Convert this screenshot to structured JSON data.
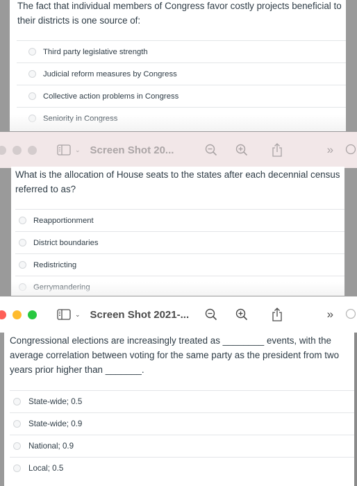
{
  "questions": [
    {
      "text": "The fact that individual members of Congress favor costly projects beneficial to their districts is one source of:",
      "answers": [
        {
          "label": "Third party legislative strength",
          "selected": false
        },
        {
          "label": "Judicial reform measures by Congress",
          "selected": false
        },
        {
          "label": "Collective action problems in Congress",
          "selected": false
        },
        {
          "label": "Seniority in Congress",
          "selected": false
        }
      ]
    },
    {
      "text": "What is the allocation of House seats to the states after each decennial census referred to as?",
      "answers": [
        {
          "label": "Reapportionment",
          "selected": false
        },
        {
          "label": "District boundaries",
          "selected": false
        },
        {
          "label": "Redistricting",
          "selected": false
        },
        {
          "label": "Gerrymandering",
          "selected": false
        }
      ]
    },
    {
      "text": "Congressional elections are increasingly treated as ________ events, with the average correlation between voting for the same party as the president from two years prior higher than _______.",
      "answers": [
        {
          "label": "State-wide; 0.5",
          "selected": false
        },
        {
          "label": "State-wide; 0.9",
          "selected": false
        },
        {
          "label": "National; 0.9",
          "selected": false
        },
        {
          "label": "Local; 0.5",
          "selected": false
        }
      ]
    }
  ],
  "toolbars": [
    {
      "title": "Screen Shot 20...",
      "state": "inactive",
      "icons": {
        "sidebar": "sidebar-icon",
        "chevron": "⌄",
        "zoom_out": "zoom-out-icon",
        "zoom_in": "zoom-in-icon",
        "share": "share-icon",
        "more": "»",
        "search": "search-icon"
      }
    },
    {
      "title": "Screen Shot 2021-...",
      "state": "active",
      "icons": {
        "sidebar": "sidebar-icon",
        "chevron": "⌄",
        "zoom_out": "zoom-out-icon",
        "zoom_in": "zoom-in-icon",
        "share": "share-icon",
        "more": "»",
        "search": "search-icon"
      }
    }
  ],
  "colors": {
    "traffic_close": "#fe5f57",
    "traffic_minimize": "#febb2e",
    "traffic_maximize": "#28c840",
    "inactive_toolbar": "#f2e7e8",
    "text": "#2d3b45"
  }
}
